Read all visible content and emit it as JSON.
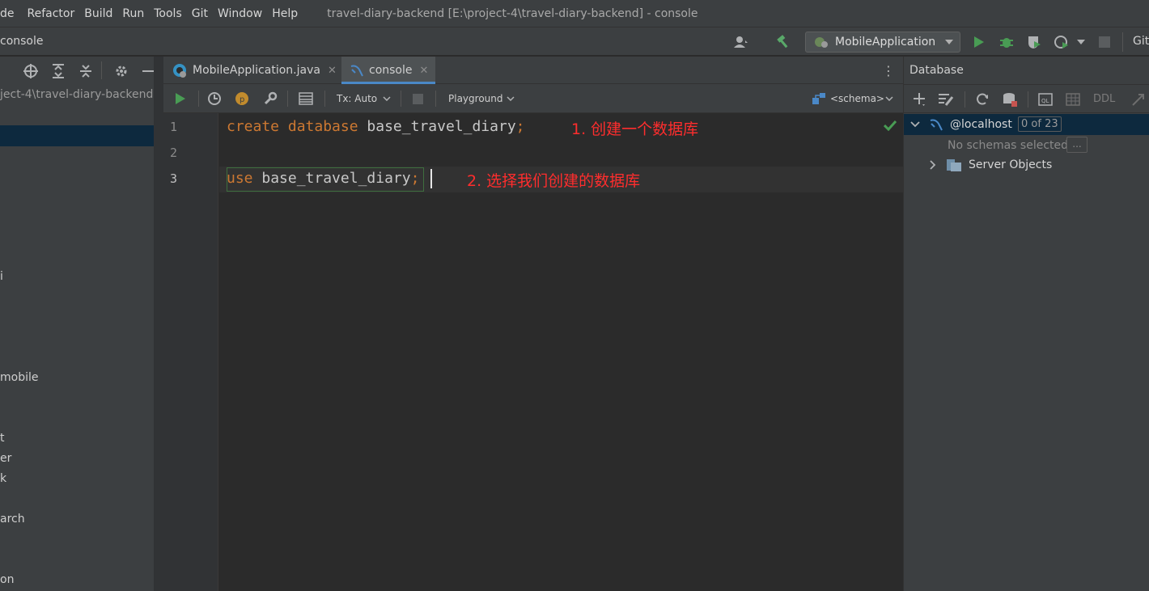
{
  "menubar": {
    "items": [
      "de",
      "Refactor",
      "Build",
      "Run",
      "Tools",
      "Git",
      "Window",
      "Help"
    ],
    "window_title": "travel-diary-backend [E:\\project-4\\travel-diary-backend] - console"
  },
  "navbar": {
    "breadcrumb": "console",
    "run_config": "MobileApplication",
    "git_label": "Git"
  },
  "project": {
    "path": "ject-4\\travel-diary-backend",
    "fragments": [
      "i",
      "mobile",
      "t",
      "er",
      "k",
      "arch",
      "on"
    ]
  },
  "tabs": [
    {
      "label": "MobileApplication.java",
      "icon": "java-class-icon",
      "active": false
    },
    {
      "label": "console",
      "icon": "mysql-console-icon",
      "active": true
    }
  ],
  "editor_toolbar": {
    "tx_mode": "Tx: Auto",
    "playground": "Playground",
    "schema": "<schema>"
  },
  "editor": {
    "line_numbers": [
      "1",
      "2",
      "3"
    ],
    "line1": {
      "kw1": "create",
      "kw2": "database",
      "ident": "base_travel_diary",
      "semi": ";"
    },
    "line3": {
      "kw1": "use",
      "ident": "base_travel_diary",
      "semi": ";"
    },
    "annotations": {
      "a1": "1. 创建一个数据库",
      "a2": "2. 选择我们创建的数据库"
    }
  },
  "database": {
    "title": "Database",
    "ddl": "DDL",
    "host": "@localhost",
    "count": "0 of 23",
    "no_schemas": "No schemas selected",
    "more": "...",
    "server_objects": "Server Objects"
  },
  "colors": {
    "keyword": "#cc7832",
    "annotation": "#ff2d2d",
    "run_green": "#499c54",
    "selection": "#0d293e",
    "tab_underline": "#4a88c7"
  }
}
